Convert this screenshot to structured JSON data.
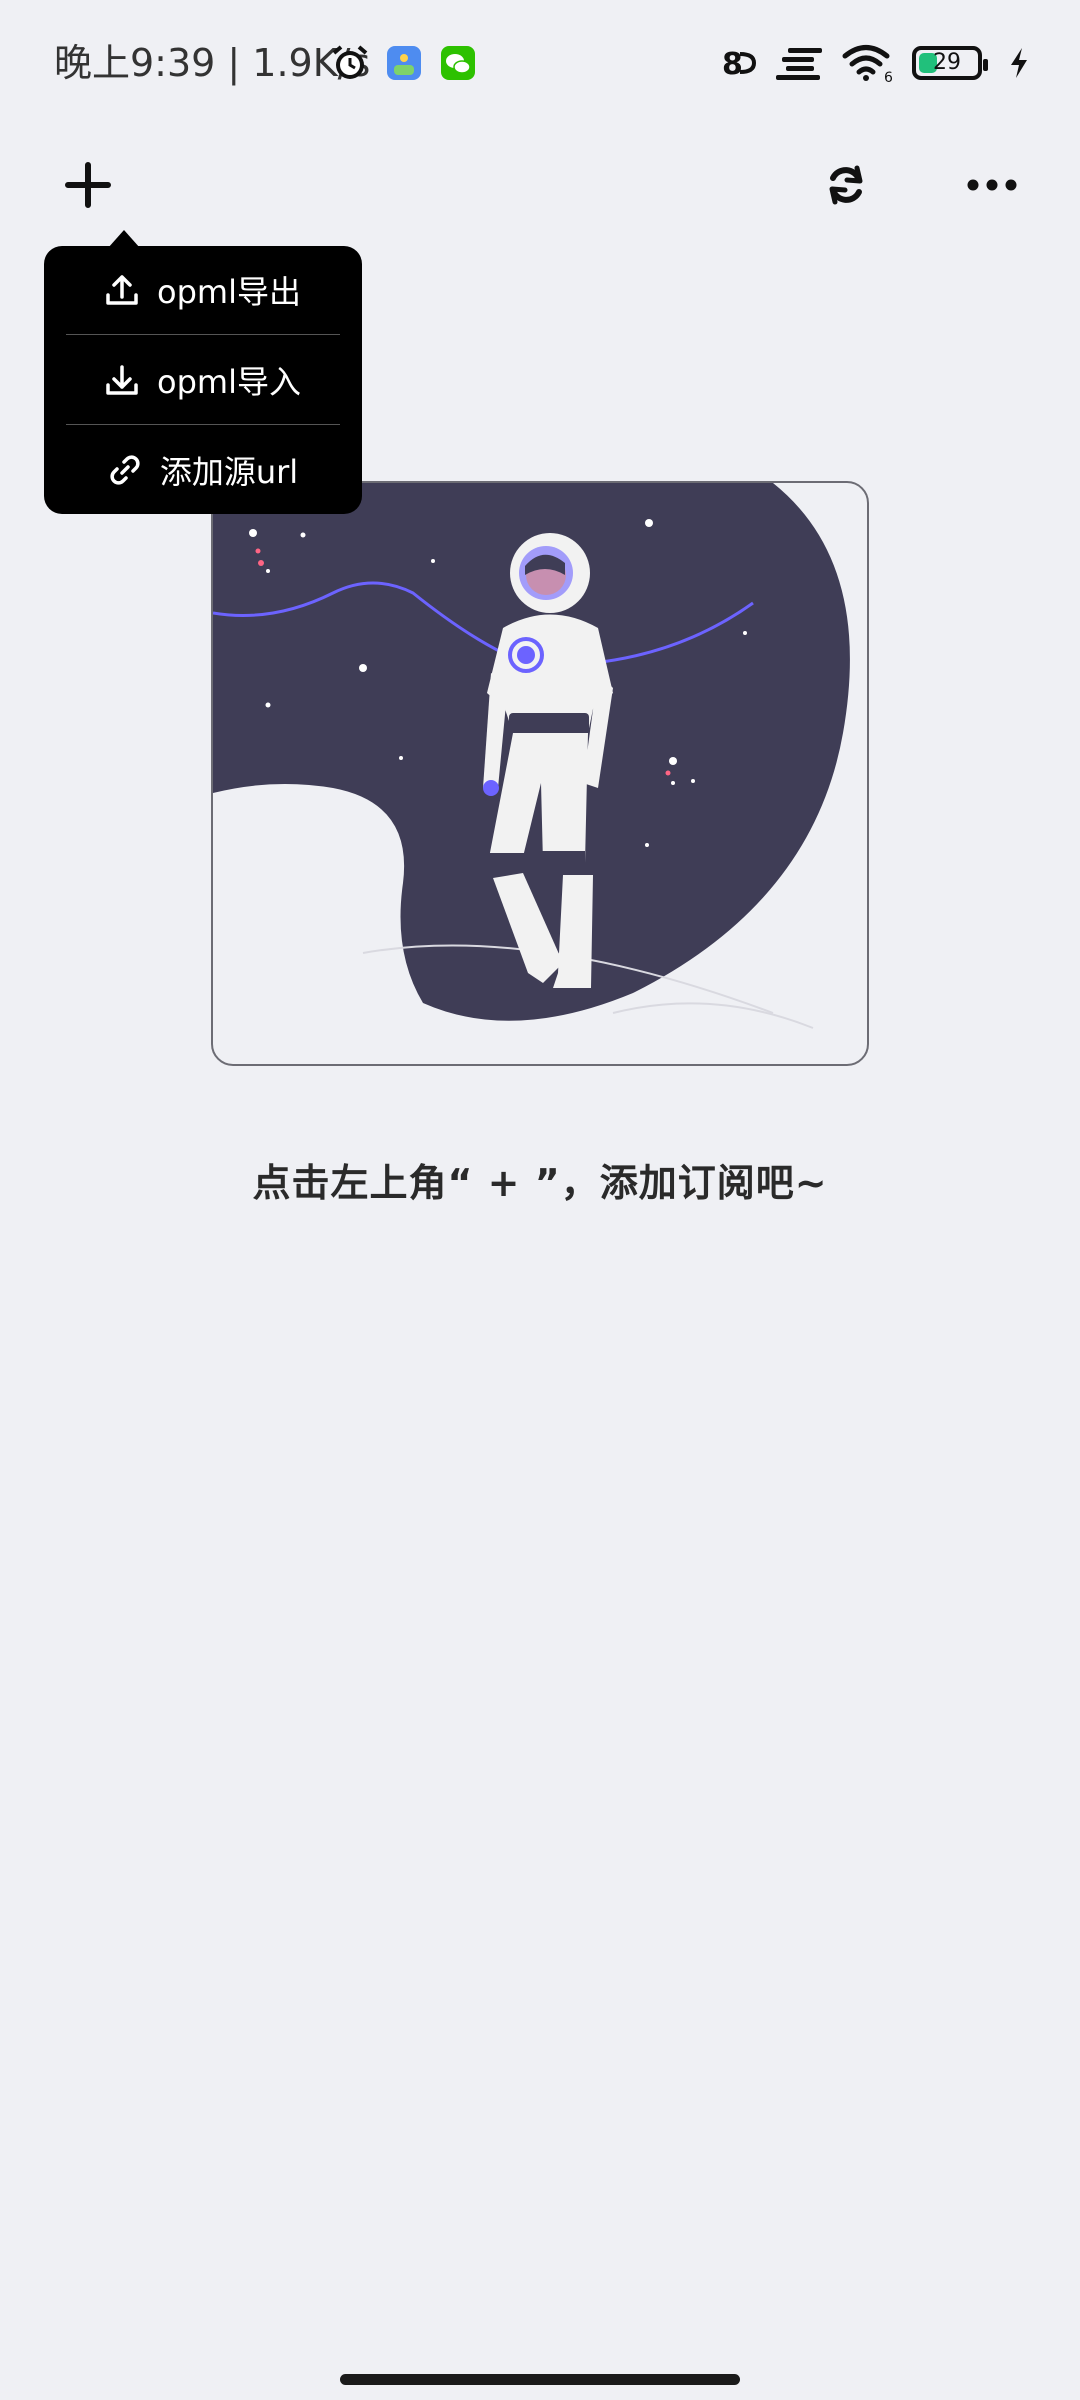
{
  "status_bar": {
    "time_speed": "晚上9:39 | 1.9K/s",
    "icons": [
      "alarm-icon",
      "game-app-icon",
      "wechat-icon"
    ],
    "right_icons": [
      "hd-icon",
      "signal-icon",
      "wifi-icon",
      "battery-icon",
      "charging-icon"
    ],
    "wifi_label": "6",
    "battery_level": "29",
    "battery_fraction": 0.29
  },
  "toolbar": {
    "add_icon": "plus-icon",
    "refresh_icon": "refresh-icon",
    "more_icon": "more-icon"
  },
  "menu": {
    "items": [
      {
        "icon": "upload-icon",
        "label": "opml导出"
      },
      {
        "icon": "download-icon",
        "label": "opml导入"
      },
      {
        "icon": "link-icon",
        "label": "添加源url"
      }
    ]
  },
  "empty_state": {
    "illustration": "astronaut-illustration",
    "message": "点击左上角“ + ”，添加订阅吧~"
  },
  "colors": {
    "background": "#eff0f4",
    "space": "#3f3d56",
    "accent": "#6c63ff",
    "battery": "#21c07b"
  }
}
